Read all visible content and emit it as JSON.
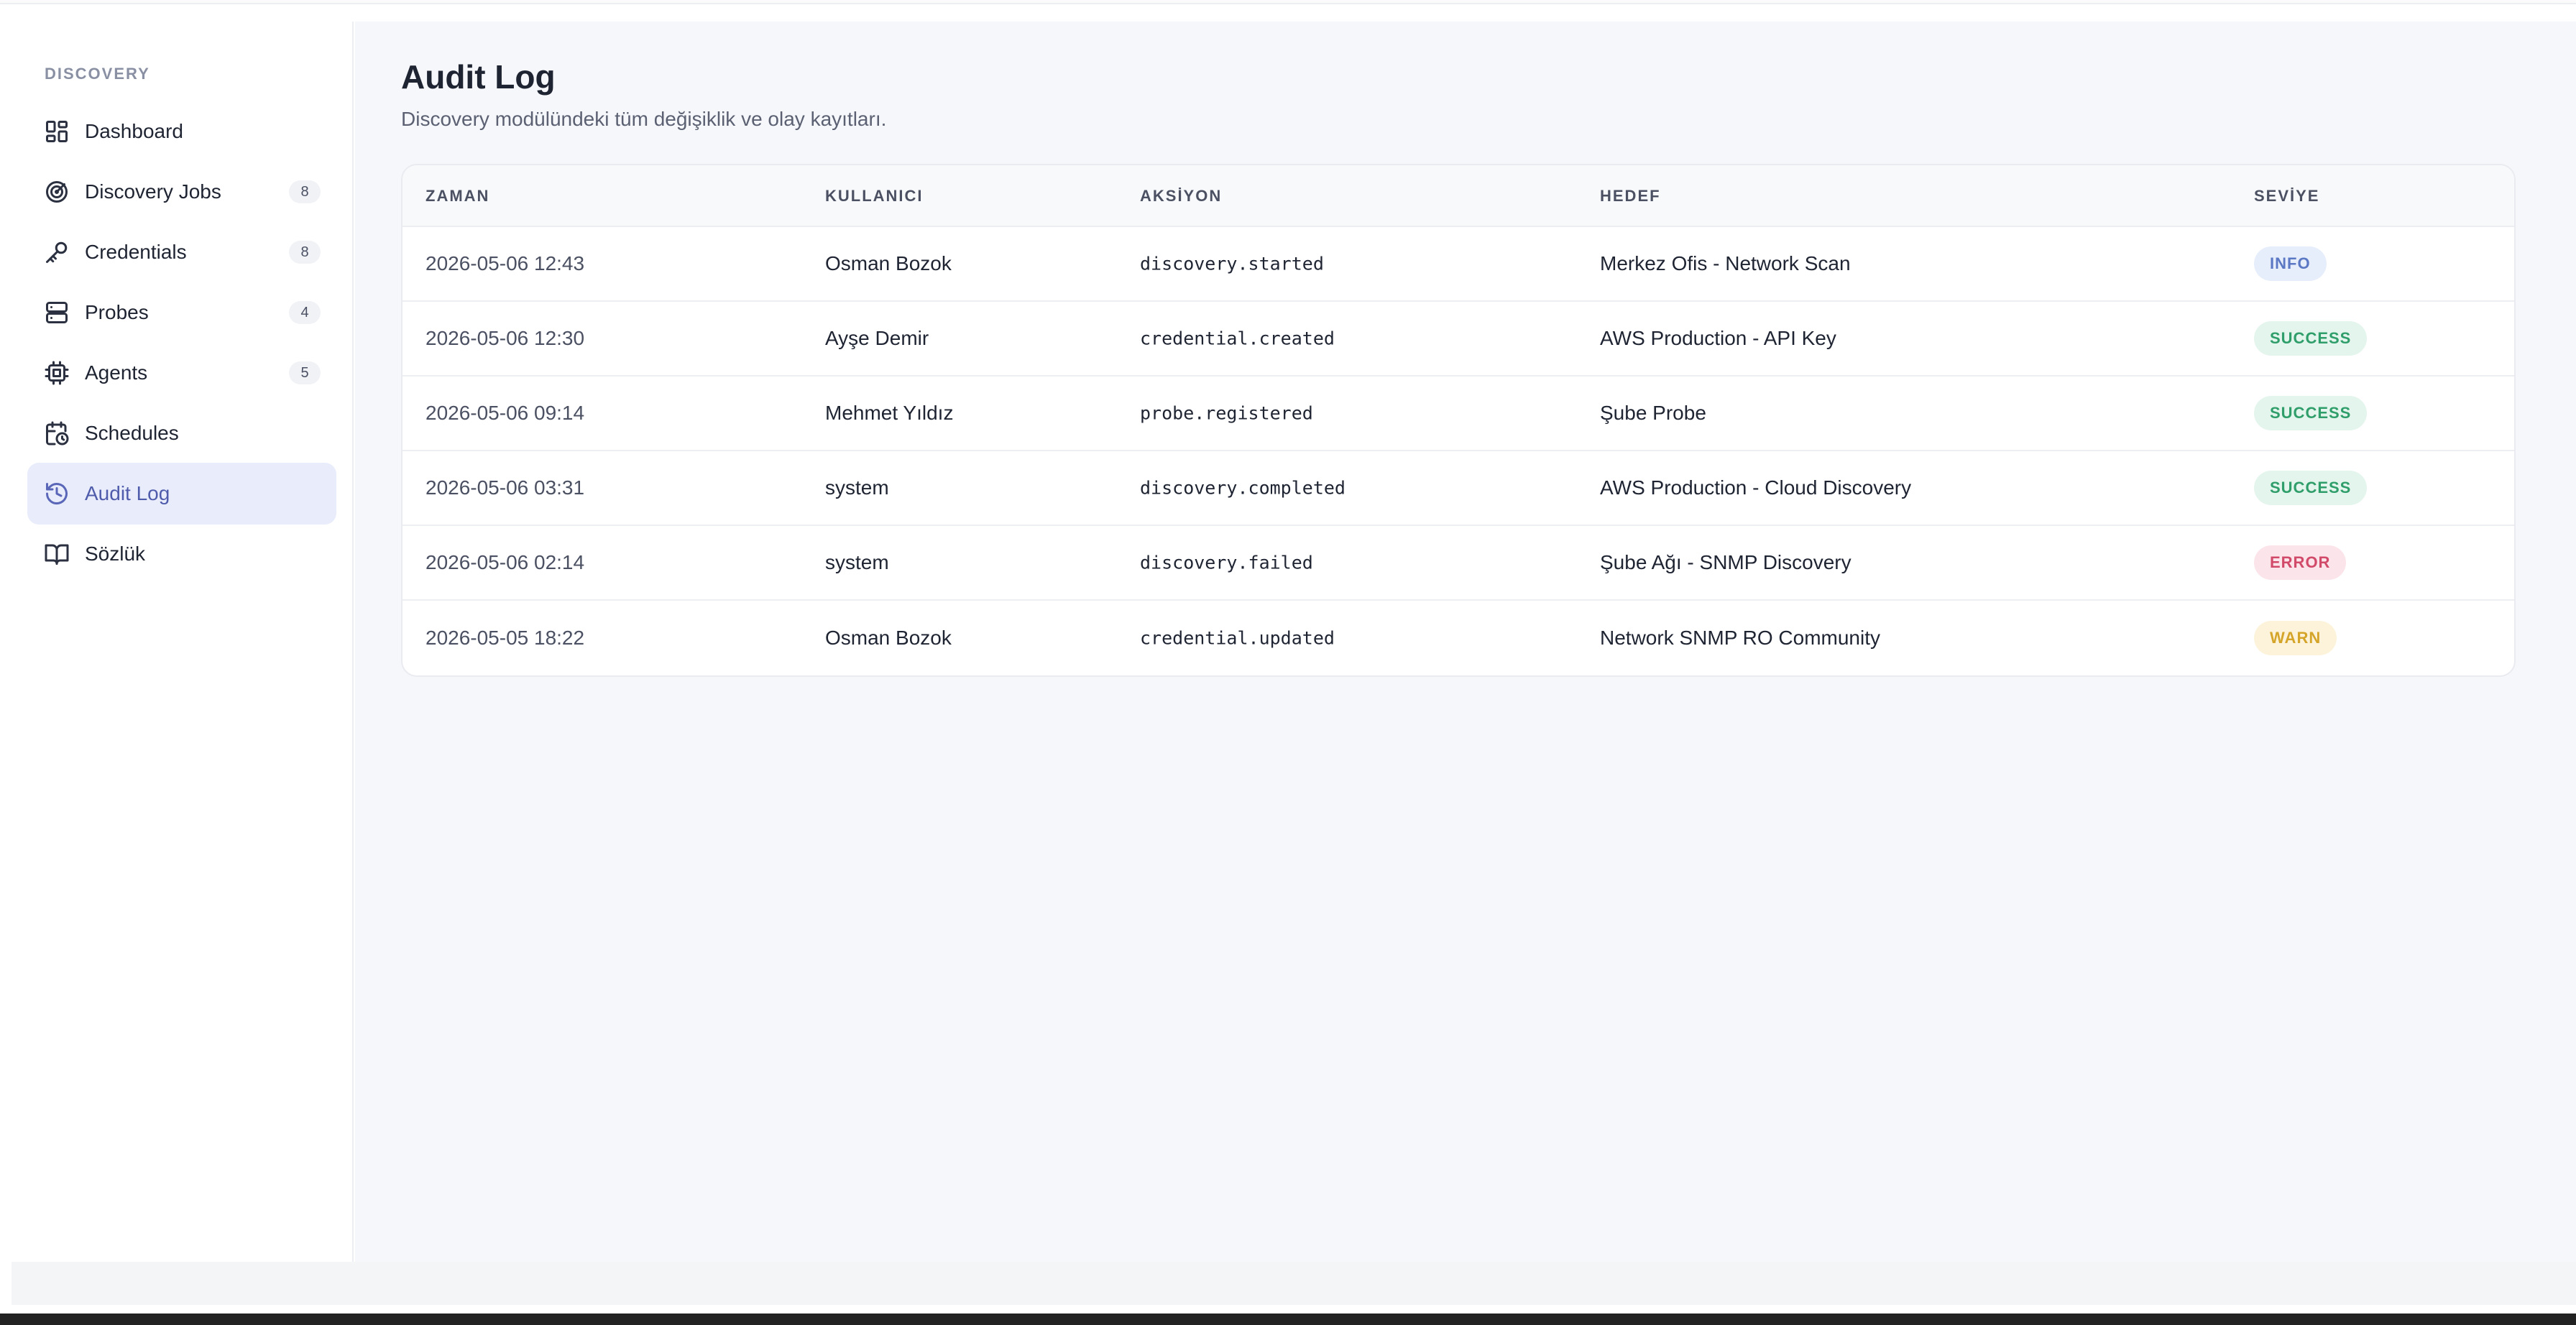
{
  "sidebar": {
    "section_title": "DISCOVERY",
    "items": [
      {
        "label": "Dashboard",
        "icon": "dashboard-icon",
        "badge": null,
        "active": false
      },
      {
        "label": "Discovery Jobs",
        "icon": "radar-icon",
        "badge": "8",
        "active": false
      },
      {
        "label": "Credentials",
        "icon": "key-icon",
        "badge": "8",
        "active": false
      },
      {
        "label": "Probes",
        "icon": "server-icon",
        "badge": "4",
        "active": false
      },
      {
        "label": "Agents",
        "icon": "cpu-icon",
        "badge": "5",
        "active": false
      },
      {
        "label": "Schedules",
        "icon": "calendar-clock-icon",
        "badge": null,
        "active": false
      },
      {
        "label": "Audit Log",
        "icon": "history-icon",
        "badge": null,
        "active": true
      },
      {
        "label": "Sözlük",
        "icon": "book-icon",
        "badge": null,
        "active": false
      }
    ]
  },
  "page": {
    "title": "Audit Log",
    "subtitle": "Discovery modülündeki tüm değişiklik ve olay kayıtları."
  },
  "table": {
    "headers": {
      "time": "ZAMAN",
      "user": "KULLANICI",
      "action": "AKSİYON",
      "target": "HEDEF",
      "level": "SEVİYE"
    },
    "rows": [
      {
        "time": "2026-05-06 12:43",
        "user": "Osman Bozok",
        "action": "discovery.started",
        "target": "Merkez Ofis - Network Scan",
        "level": "INFO"
      },
      {
        "time": "2026-05-06 12:30",
        "user": "Ayşe Demir",
        "action": "credential.created",
        "target": "AWS Production - API Key",
        "level": "SUCCESS"
      },
      {
        "time": "2026-05-06 09:14",
        "user": "Mehmet Yıldız",
        "action": "probe.registered",
        "target": "Şube Probe",
        "level": "SUCCESS"
      },
      {
        "time": "2026-05-06 03:31",
        "user": "system",
        "action": "discovery.completed",
        "target": "AWS Production - Cloud Discovery",
        "level": "SUCCESS"
      },
      {
        "time": "2026-05-06 02:14",
        "user": "system",
        "action": "discovery.failed",
        "target": "Şube Ağı - SNMP Discovery",
        "level": "ERROR"
      },
      {
        "time": "2026-05-05 18:22",
        "user": "Osman Bozok",
        "action": "credential.updated",
        "target": "Network SNMP RO Community",
        "level": "WARN"
      }
    ]
  },
  "level_colors": {
    "INFO": {
      "bg": "#e6edfb",
      "fg": "#5a78c4"
    },
    "SUCCESS": {
      "bg": "#e3f5ec",
      "fg": "#2f9e6a"
    },
    "ERROR": {
      "bg": "#fbe4ea",
      "fg": "#d24a6a"
    },
    "WARN": {
      "bg": "#fcf3da",
      "fg": "#d5a52a"
    }
  }
}
